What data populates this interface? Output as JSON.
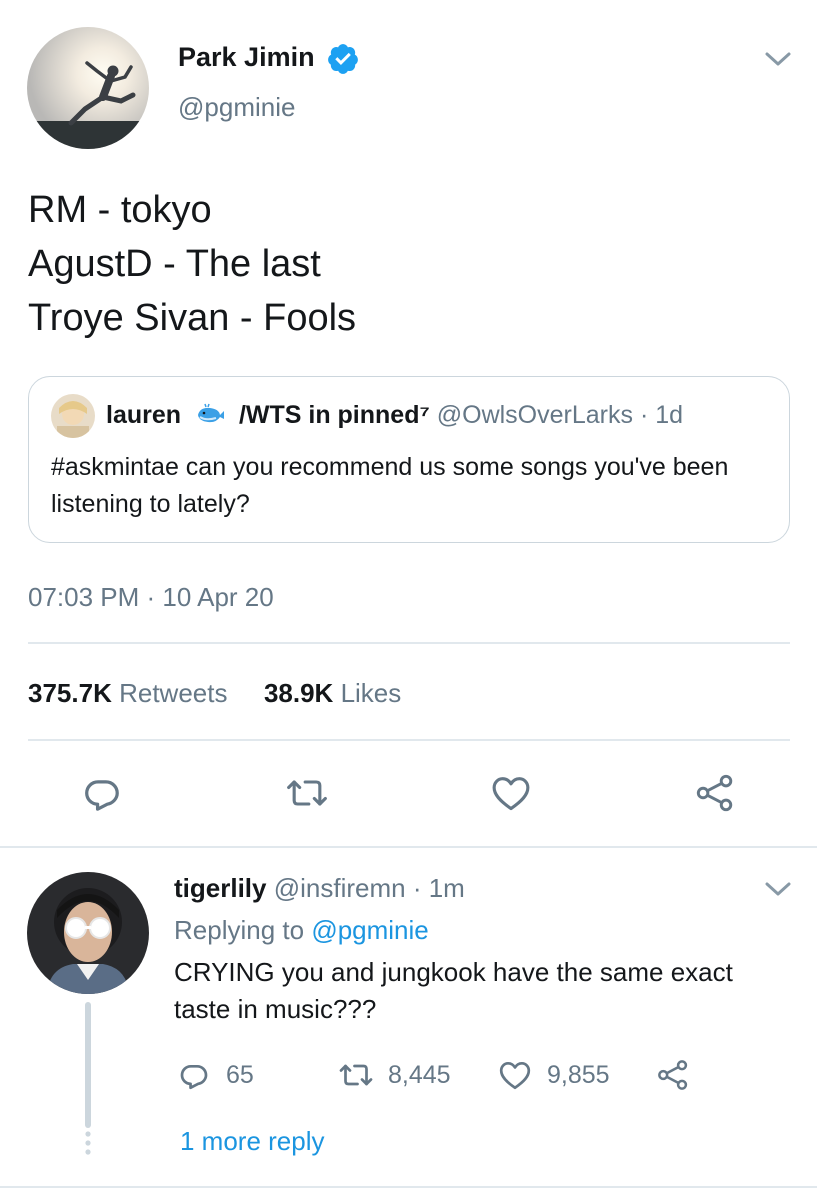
{
  "main_tweet": {
    "author_name": "Park Jimin",
    "author_handle": "@pgminie",
    "text_lines": [
      "RM - tokyo",
      "AgustD - The last",
      "Troye Sivan - Fools"
    ],
    "timestamp": "07:03 PM · 10 Apr 20",
    "retweets_count": "375.7K",
    "retweets_label": "Retweets",
    "likes_count": "38.9K",
    "likes_label": "Likes"
  },
  "quoted_tweet": {
    "author_name": "lauren",
    "name_suffix": "/WTS in pinned⁷",
    "author_handle": "@OwlsOverLarks",
    "age": " · 1d",
    "text": "#askmintae can you recommend us some songs you've been listening to lately?"
  },
  "reply": {
    "author_name": "tigerlily",
    "author_handle": "@insfiremn",
    "age": " · 1m",
    "replying_prefix": "Replying to ",
    "replying_to": "@pgminie",
    "text": "CRYING you and jungkook have the same exact taste in music???",
    "reply_count": "65",
    "retweet_count": "8,445",
    "like_count": "9,855",
    "more_replies": "1 more reply"
  },
  "colors": {
    "text": "#14171a",
    "secondary": "#657786",
    "accent": "#1b95e0",
    "verified": "#1da1f2",
    "border": "#e1e8ed"
  },
  "icons": [
    "verified-badge-icon",
    "chevron-down-icon",
    "comment-icon",
    "retweet-icon",
    "heart-icon",
    "share-icon",
    "whale-emoji-icon"
  ]
}
